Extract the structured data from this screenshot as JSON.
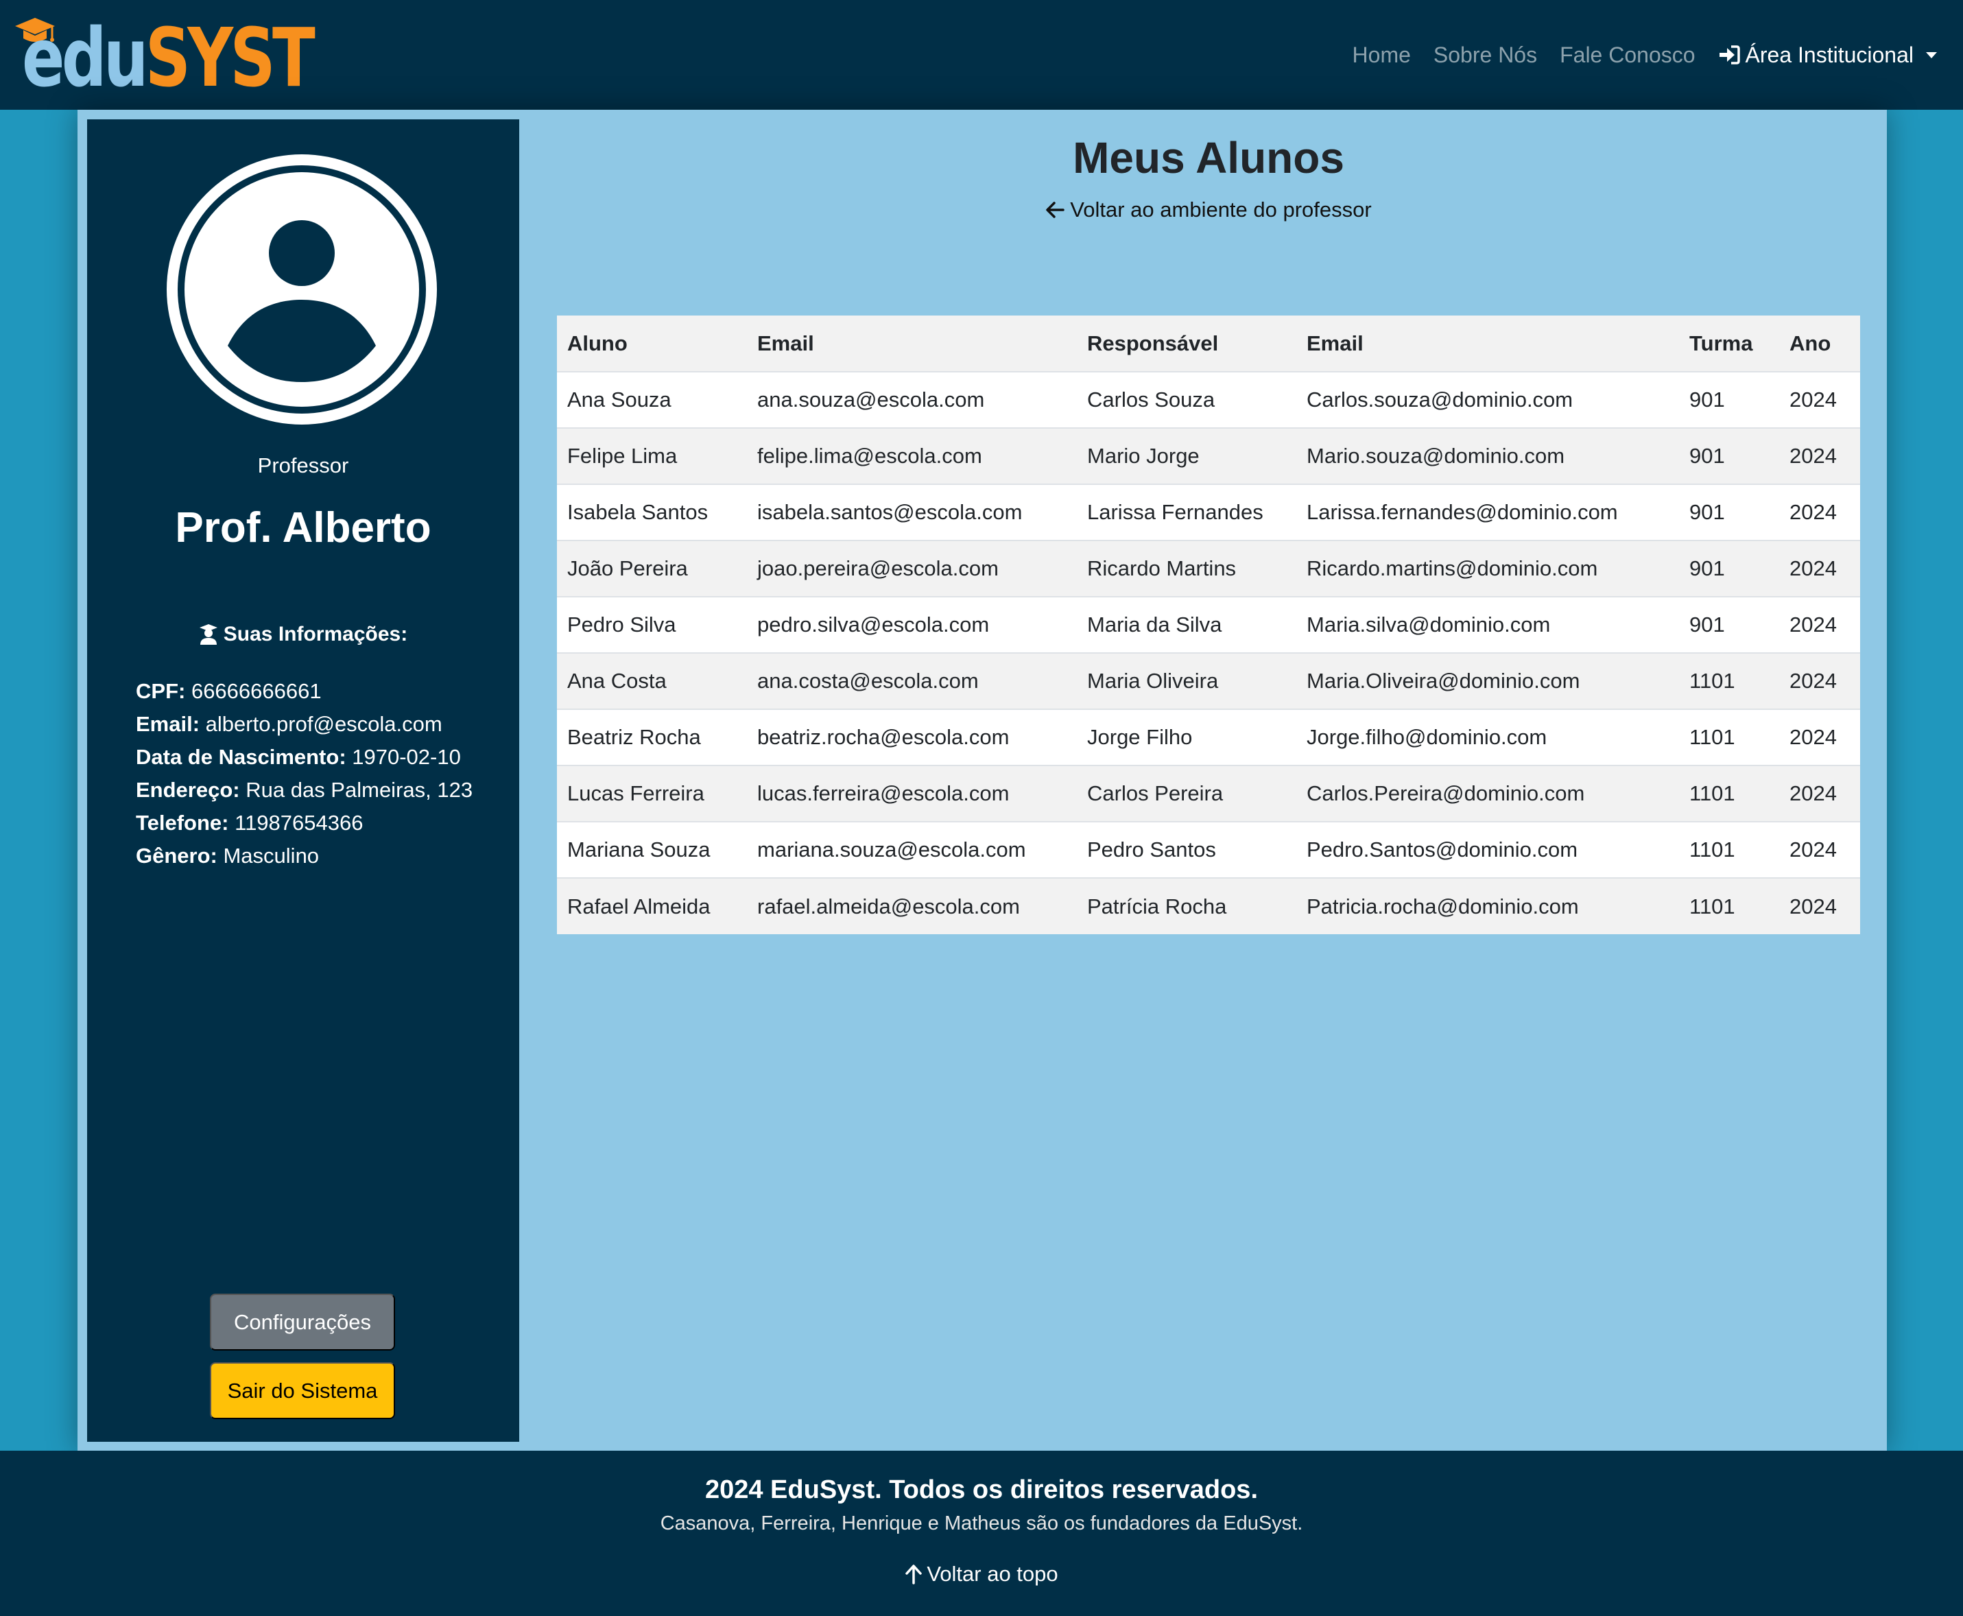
{
  "brand": {
    "logo_prefix": "edu",
    "logo_suffix": "SYST"
  },
  "nav": {
    "items": [
      "Home",
      "Sobre Nós",
      "Fale Conosco"
    ],
    "institutional": "Área Institucional"
  },
  "profile": {
    "role": "Professor",
    "name": "Prof. Alberto",
    "info_title": "Suas Informações:",
    "fields": [
      {
        "label": "CPF:",
        "value": "66666666661"
      },
      {
        "label": "Email:",
        "value": "alberto.prof@escola.com"
      },
      {
        "label": "Data de Nascimento:",
        "value": "1970-02-10"
      },
      {
        "label": "Endereço:",
        "value": "Rua das Palmeiras, 123"
      },
      {
        "label": "Telefone:",
        "value": "11987654366"
      },
      {
        "label": "Gênero:",
        "value": "Masculino"
      }
    ],
    "config_button": "Configurações",
    "exit_button": "Sair do Sistema"
  },
  "main": {
    "title": "Meus Alunos",
    "back_link": "Voltar ao ambiente do professor",
    "table": {
      "headers": [
        "Aluno",
        "Email",
        "Responsável",
        "Email",
        "Turma",
        "Ano"
      ],
      "rows": [
        [
          "Ana Souza",
          "ana.souza@escola.com",
          "Carlos Souza",
          "Carlos.souza@dominio.com",
          "901",
          "2024"
        ],
        [
          "Felipe Lima",
          "felipe.lima@escola.com",
          "Mario Jorge",
          "Mario.souza@dominio.com",
          "901",
          "2024"
        ],
        [
          "Isabela Santos",
          "isabela.santos@escola.com",
          "Larissa Fernandes",
          "Larissa.fernandes@dominio.com",
          "901",
          "2024"
        ],
        [
          "João Pereira",
          "joao.pereira@escola.com",
          "Ricardo Martins",
          "Ricardo.martins@dominio.com",
          "901",
          "2024"
        ],
        [
          "Pedro Silva",
          "pedro.silva@escola.com",
          "Maria da Silva",
          "Maria.silva@dominio.com",
          "901",
          "2024"
        ],
        [
          "Ana Costa",
          "ana.costa@escola.com",
          "Maria Oliveira",
          "Maria.Oliveira@dominio.com",
          "1101",
          "2024"
        ],
        [
          "Beatriz Rocha",
          "beatriz.rocha@escola.com",
          "Jorge Filho",
          "Jorge.filho@dominio.com",
          "1101",
          "2024"
        ],
        [
          "Lucas Ferreira",
          "lucas.ferreira@escola.com",
          "Carlos Pereira",
          "Carlos.Pereira@dominio.com",
          "1101",
          "2024"
        ],
        [
          "Mariana Souza",
          "mariana.souza@escola.com",
          "Pedro Santos",
          "Pedro.Santos@dominio.com",
          "1101",
          "2024"
        ],
        [
          "Rafael Almeida",
          "rafael.almeida@escola.com",
          "Patrícia Rocha",
          "Patricia.rocha@dominio.com",
          "1101",
          "2024"
        ]
      ]
    }
  },
  "footer": {
    "copyright": "2024 EduSyst. Todos os direitos reservados.",
    "founders": "Casanova, Ferreira, Henrique e Matheus são os fundadores da EduSyst.",
    "back_to_top": "Voltar ao topo"
  },
  "colors": {
    "navbar": "#012f47",
    "background": "#2097bd",
    "panel": "#8fc8e5",
    "logo_edu": "#8fc6e8",
    "logo_syst": "#f7901e",
    "exit_button": "#ffc107",
    "config_button": "#6c757d"
  },
  "icons": {
    "logo": "graduation-cap-icon",
    "institutional": "sign-in-icon",
    "info": "user-graduate-icon",
    "back": "arrow-left-icon",
    "top": "arrow-up-icon"
  }
}
